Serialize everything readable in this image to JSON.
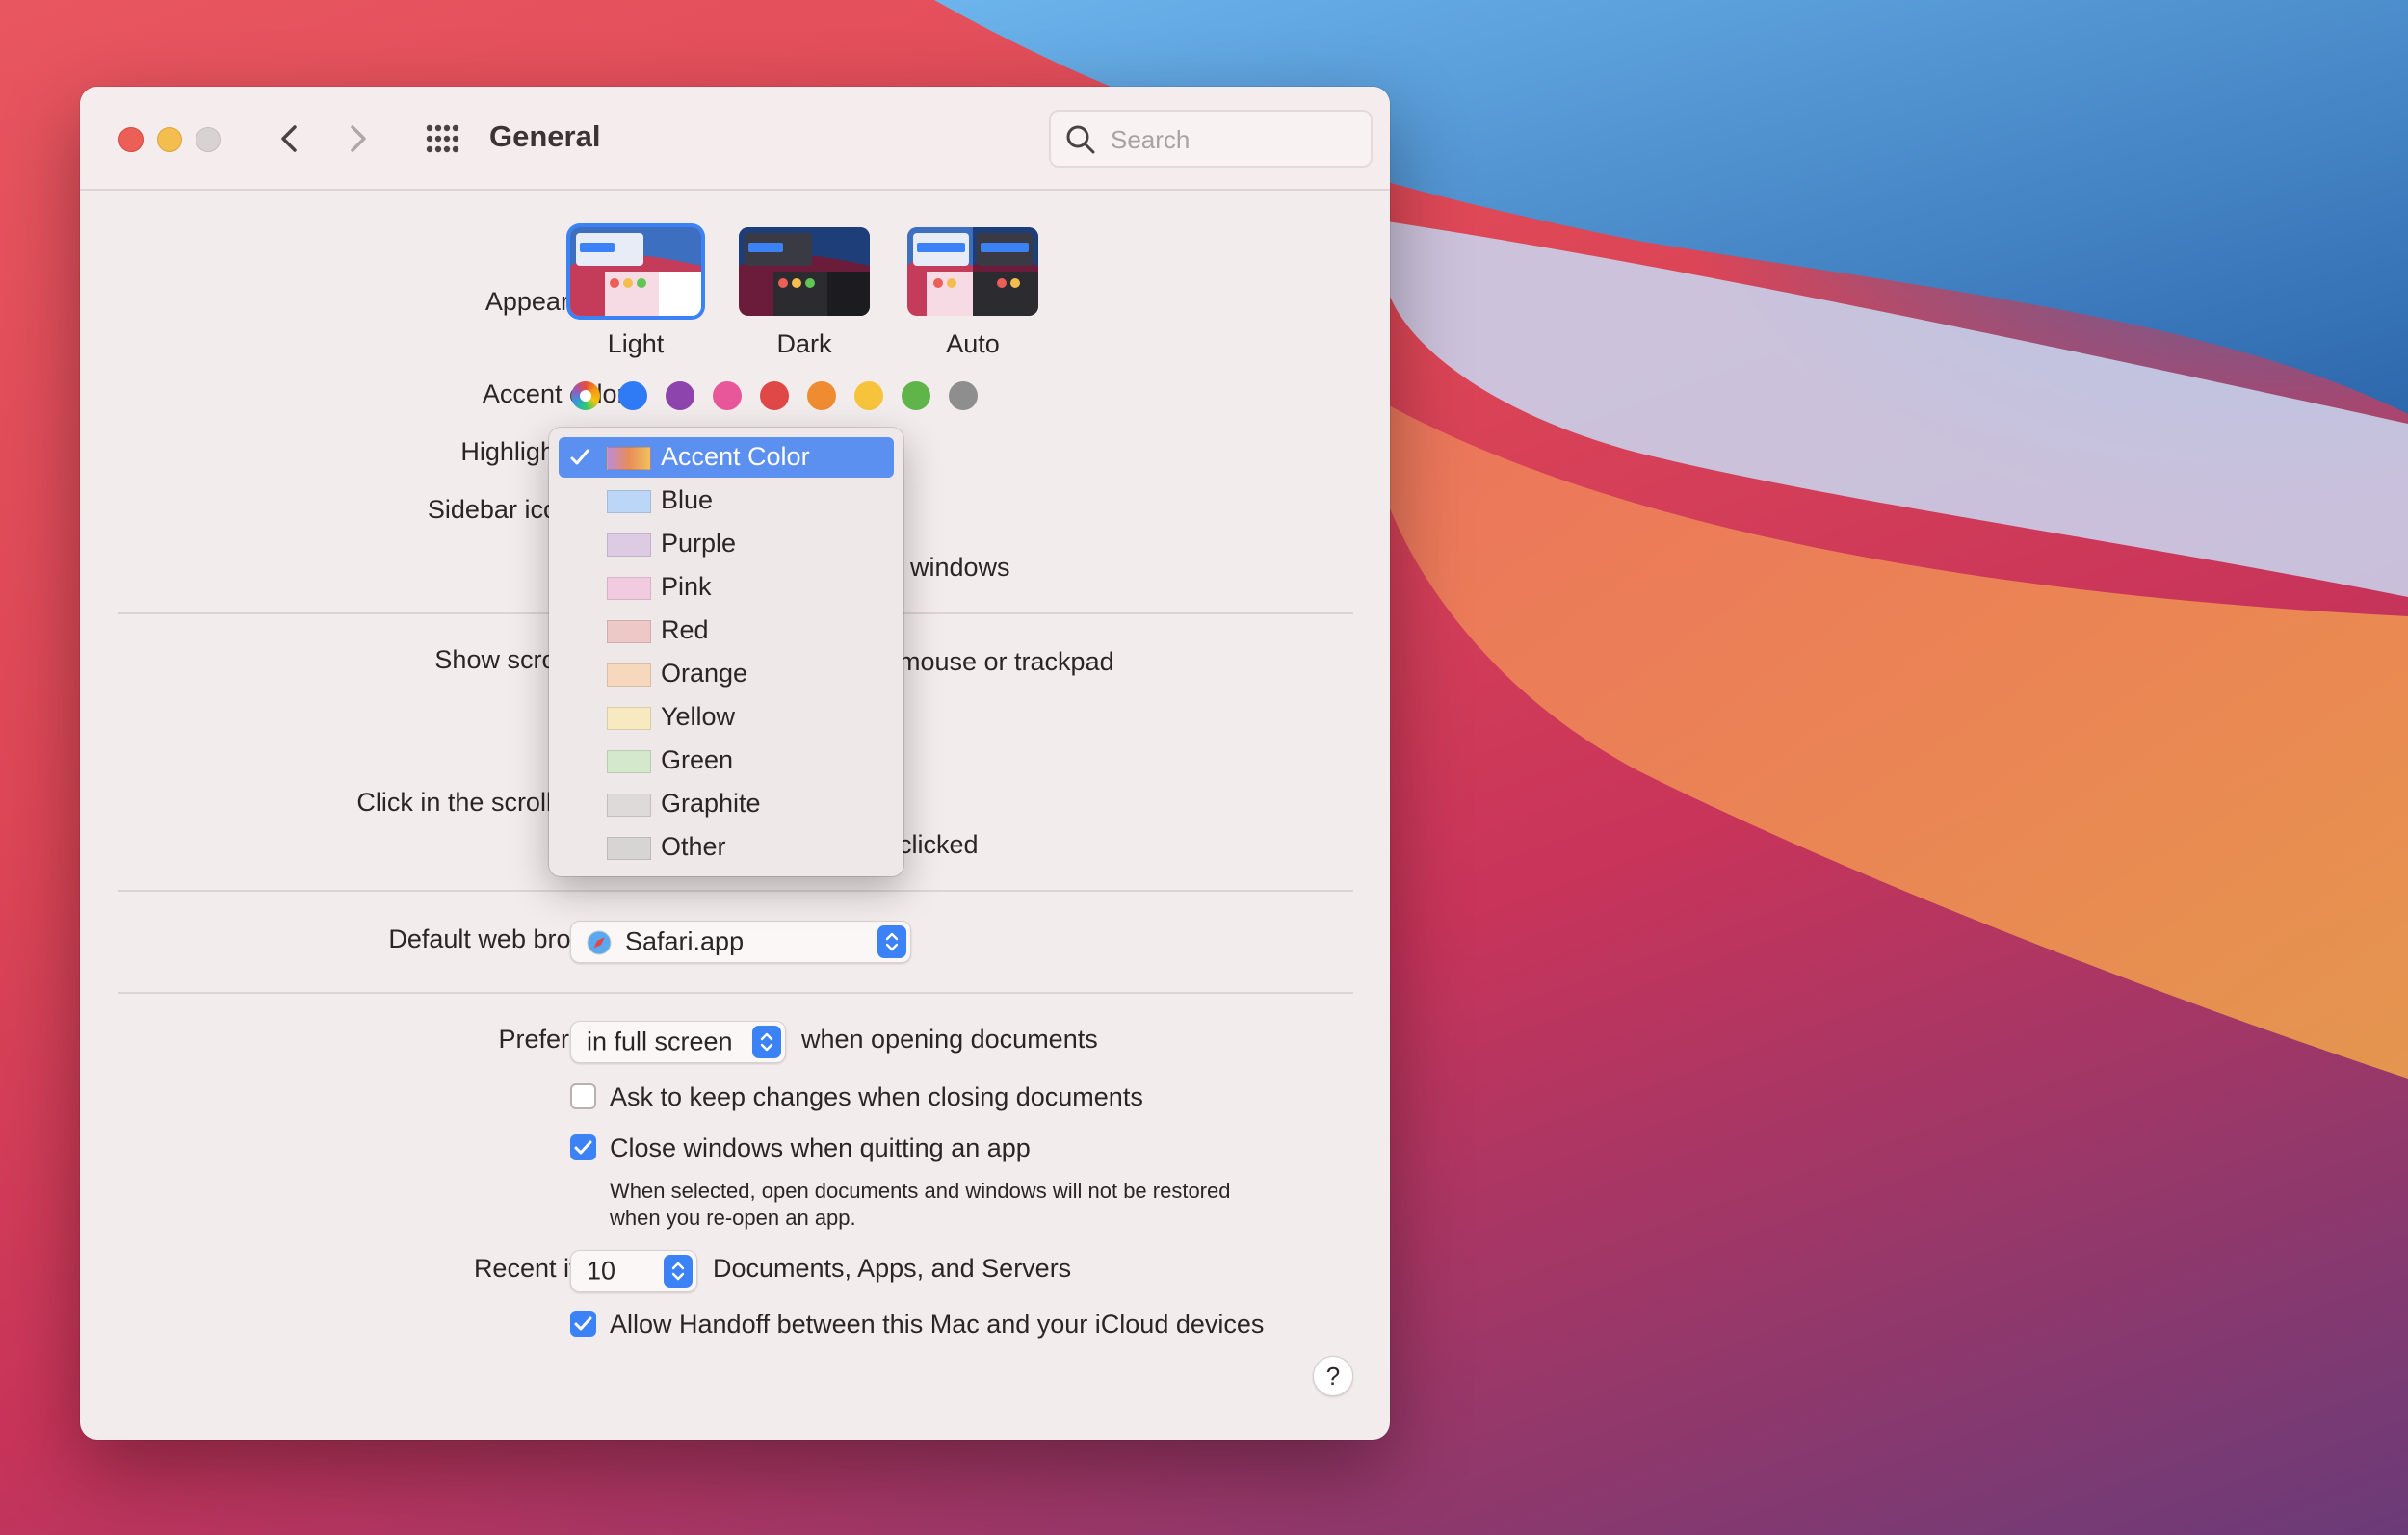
{
  "window": {
    "title": "General",
    "search_placeholder": "Search"
  },
  "appearance": {
    "label": "Appearance:",
    "options": [
      "Light",
      "Dark",
      "Auto"
    ],
    "selected": "Light"
  },
  "accent": {
    "label": "Accent color:",
    "colors": [
      "multicolor",
      "#2f7bf5",
      "#8e44ad",
      "#e8579a",
      "#e04848",
      "#ef8c31",
      "#f6c33a",
      "#5fb44a",
      "#8e8e8e"
    ]
  },
  "highlight": {
    "label": "Highlight color:"
  },
  "sidebar_icon": {
    "label": "Sidebar icon size:"
  },
  "wallpaper_tint": {
    "partial_text": "windows"
  },
  "scroll_bars": {
    "label": "Show scroll bars:",
    "partial_text": "mouse or trackpad"
  },
  "click_scroll": {
    "label": "Click in the scroll bar to:",
    "partial_text": "clicked"
  },
  "browser": {
    "label": "Default web browser:",
    "value": "Safari.app"
  },
  "tabs": {
    "label": "Prefer tabs:",
    "value": "in full screen",
    "suffix": "when opening documents"
  },
  "checkboxes": {
    "ask_keep": {
      "label": "Ask to keep changes when closing documents",
      "checked": false
    },
    "close_windows": {
      "label": "Close windows when quitting an app",
      "checked": true
    },
    "close_windows_note_1": "When selected, open documents and windows will not be restored",
    "close_windows_note_2": "when you re-open an app.",
    "handoff": {
      "label": "Allow Handoff between this Mac and your iCloud devices",
      "checked": true
    }
  },
  "recent": {
    "label": "Recent items:",
    "value": "10",
    "suffix": "Documents, Apps, and Servers"
  },
  "help_label": "?",
  "highlight_menu": {
    "selected": "Accent Color",
    "items": [
      {
        "label": "Accent Color",
        "color": "gradient"
      },
      {
        "label": "Blue",
        "color": "#bcd6f7"
      },
      {
        "label": "Purple",
        "color": "#dccbe3"
      },
      {
        "label": "Pink",
        "color": "#f3cbe0"
      },
      {
        "label": "Red",
        "color": "#eec7c7"
      },
      {
        "label": "Orange",
        "color": "#f6d8bd"
      },
      {
        "label": "Yellow",
        "color": "#f7eac0"
      },
      {
        "label": "Green",
        "color": "#d4e9cc"
      },
      {
        "label": "Graphite",
        "color": "#dedada"
      },
      {
        "label": "Other",
        "color": "#d7d4d4"
      }
    ]
  }
}
